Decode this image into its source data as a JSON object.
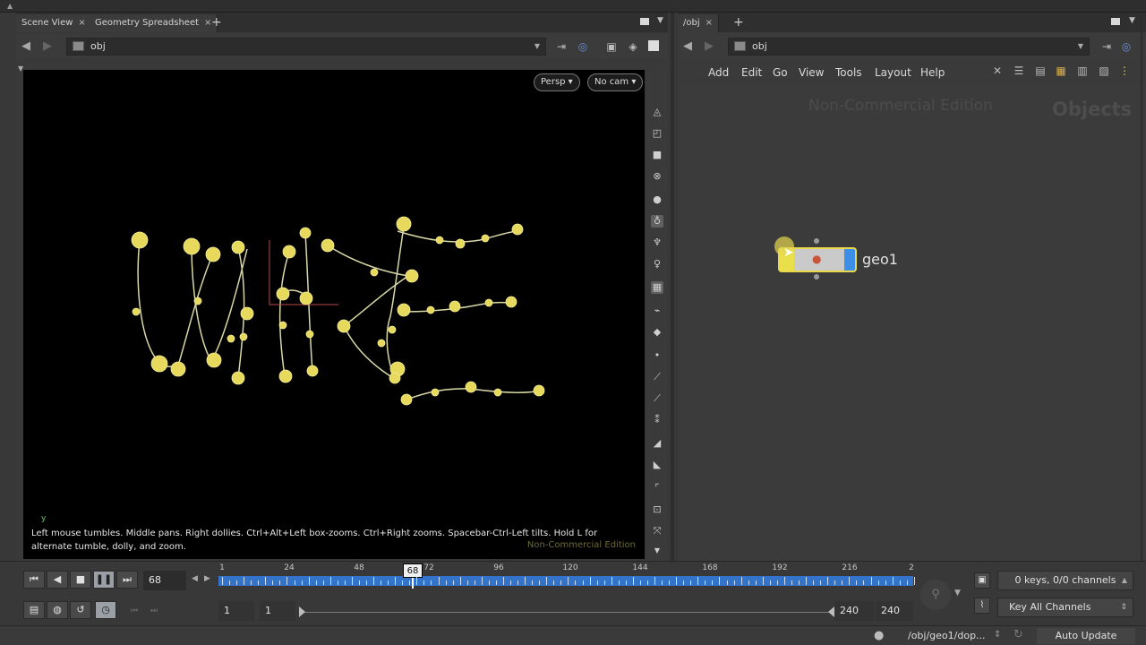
{
  "left_pane": {
    "tabs": [
      {
        "label": "Scene View"
      },
      {
        "label": "Geometry Spreadsheet"
      }
    ],
    "path": "obj",
    "viewport": {
      "persp_label": "Persp ▾",
      "cam_label": "No cam ▾",
      "hint": "Left mouse tumbles. Middle pans. Right dollies. Ctrl+Alt+Left box-zooms. Ctrl+Right zooms. Spacebar-Ctrl-Left tilts. Hold L for alternate tumble, dolly, and zoom.",
      "edition": "Non-Commercial Edition",
      "axis_label": "y"
    }
  },
  "right_pane": {
    "tab": "/obj",
    "path": "obj",
    "menu": [
      "Add",
      "Edit",
      "Go",
      "View",
      "Tools",
      "Layout",
      "Help"
    ],
    "edition": "Non-Commercial Edition",
    "context_label": "Objects",
    "node": {
      "name": "geo1"
    }
  },
  "timeline": {
    "current_frame": "68",
    "ruler_labels": [
      "1",
      "24",
      "48",
      "72",
      "96",
      "120",
      "144",
      "168",
      "192",
      "216"
    ],
    "ruler_end_label": "2",
    "range_start_a": "1",
    "range_start_b": "1",
    "range_end_a": "240",
    "range_end_b": "240",
    "keys_info": "0 keys, 0/0 channels",
    "key_all": "Key All Channels"
  },
  "status": {
    "path": "/obj/geo1/dop...",
    "auto_update": "Auto Update"
  },
  "colors": {
    "curve": "#e8dc6a",
    "timeline_bar": "#3373c9",
    "node_highlight": "#e9df4b"
  }
}
